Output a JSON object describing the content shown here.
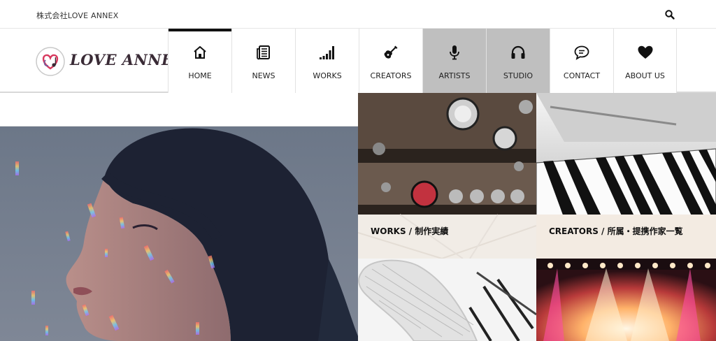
{
  "topbar": {
    "company_name": "株式会社LOVE ANNEX",
    "search_icon": "search-icon"
  },
  "logo": {
    "text": "LOVE ANNEX",
    "colors": {
      "heart": "#d8395e",
      "text": "#3a2b36"
    }
  },
  "nav": {
    "items": [
      {
        "label": "HOME",
        "icon": "home-icon"
      },
      {
        "label": "NEWS",
        "icon": "news-icon"
      },
      {
        "label": "WORKS",
        "icon": "bars-icon"
      },
      {
        "label": "CREATORS",
        "icon": "guitar-icon"
      },
      {
        "label": "ARTISTS",
        "icon": "microphone-icon"
      },
      {
        "label": "STUDIO",
        "icon": "headphones-icon"
      },
      {
        "label": "CONTACT",
        "icon": "chat-icon"
      },
      {
        "label": "ABOUT US",
        "icon": "heart-icon"
      }
    ],
    "active": "HOME",
    "highlighted": [
      "ARTISTS",
      "STUDIO"
    ]
  },
  "tiles": {
    "works": {
      "caption": "WORKS / 制作実績"
    },
    "creators": {
      "caption": "CREATORS / 所属・提携作家一覧"
    }
  },
  "colors": {
    "nav_highlight": "#bfbfbf",
    "active_bar": "#111111",
    "caption_band": "#f1ece6"
  }
}
